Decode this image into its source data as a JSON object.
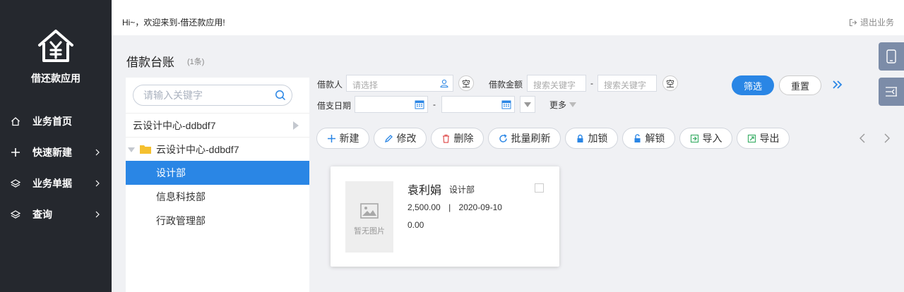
{
  "app": {
    "name": "借还款应用"
  },
  "header": {
    "greeting": "Hi~，欢迎来到-借还款应用!",
    "logout_label": "退出业务"
  },
  "nav": [
    {
      "label": "业务首页",
      "icon": "home-icon"
    },
    {
      "label": "快速新建",
      "icon": "plus-icon"
    },
    {
      "label": "业务单据",
      "icon": "layers-icon"
    },
    {
      "label": "查询",
      "icon": "layers-icon"
    }
  ],
  "page": {
    "title": "借款台账",
    "count": "(1条)"
  },
  "tree": {
    "search_placeholder": "请输入关键字",
    "rows": [
      {
        "label": "云设计中心-ddbdf7"
      },
      {
        "label": "云设计中心-ddbdf7"
      },
      {
        "label": "设计部"
      },
      {
        "label": "信息科技部"
      },
      {
        "label": "行政管理部"
      }
    ]
  },
  "filter": {
    "borrower_label": "借款人",
    "borrower_placeholder": "请选择",
    "amount_label": "借款金额",
    "amount_from_placeholder": "搜索关键字",
    "amount_to_placeholder": "搜索关键字",
    "date_label": "借支日期",
    "dash": "-",
    "clear_label": "空",
    "more_label": "更多",
    "filter_button": "筛选",
    "reset_button": "重置"
  },
  "toolbar": {
    "new": "新建",
    "edit": "修改",
    "delete": "删除",
    "batch_refresh": "批量刷新",
    "lock": "加锁",
    "unlock": "解锁",
    "import": "导入",
    "export": "导出"
  },
  "records": [
    {
      "name": "袁利娟",
      "dept": "设计部",
      "amount": "2,500.00",
      "separator": "|",
      "date": "2020-09-10",
      "balance": "0.00",
      "image_placeholder": "暂无图片"
    }
  ],
  "colors": {
    "sidebar": "#25282e",
    "accent": "#2a86e5",
    "right_tab": "#7c8ca8"
  }
}
